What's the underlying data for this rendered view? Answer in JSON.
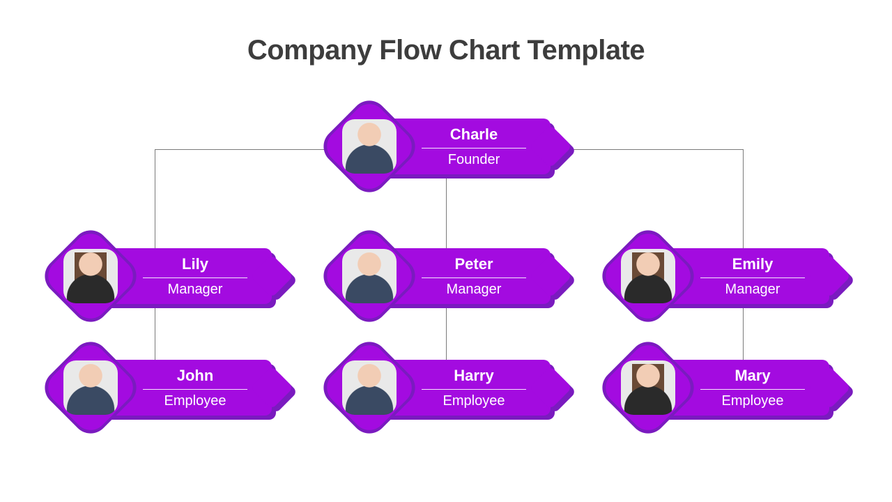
{
  "title": "Company Flow Chart Template",
  "accent": "#a30be0",
  "nodes": {
    "founder": {
      "name": "Charle",
      "role": "Founder"
    },
    "mgr1": {
      "name": "Lily",
      "role": "Manager"
    },
    "mgr2": {
      "name": "Peter",
      "role": "Manager"
    },
    "mgr3": {
      "name": "Emily",
      "role": "Manager"
    },
    "emp1": {
      "name": "John",
      "role": "Employee"
    },
    "emp2": {
      "name": "Harry",
      "role": "Employee"
    },
    "emp3": {
      "name": "Mary",
      "role": "Employee"
    }
  }
}
